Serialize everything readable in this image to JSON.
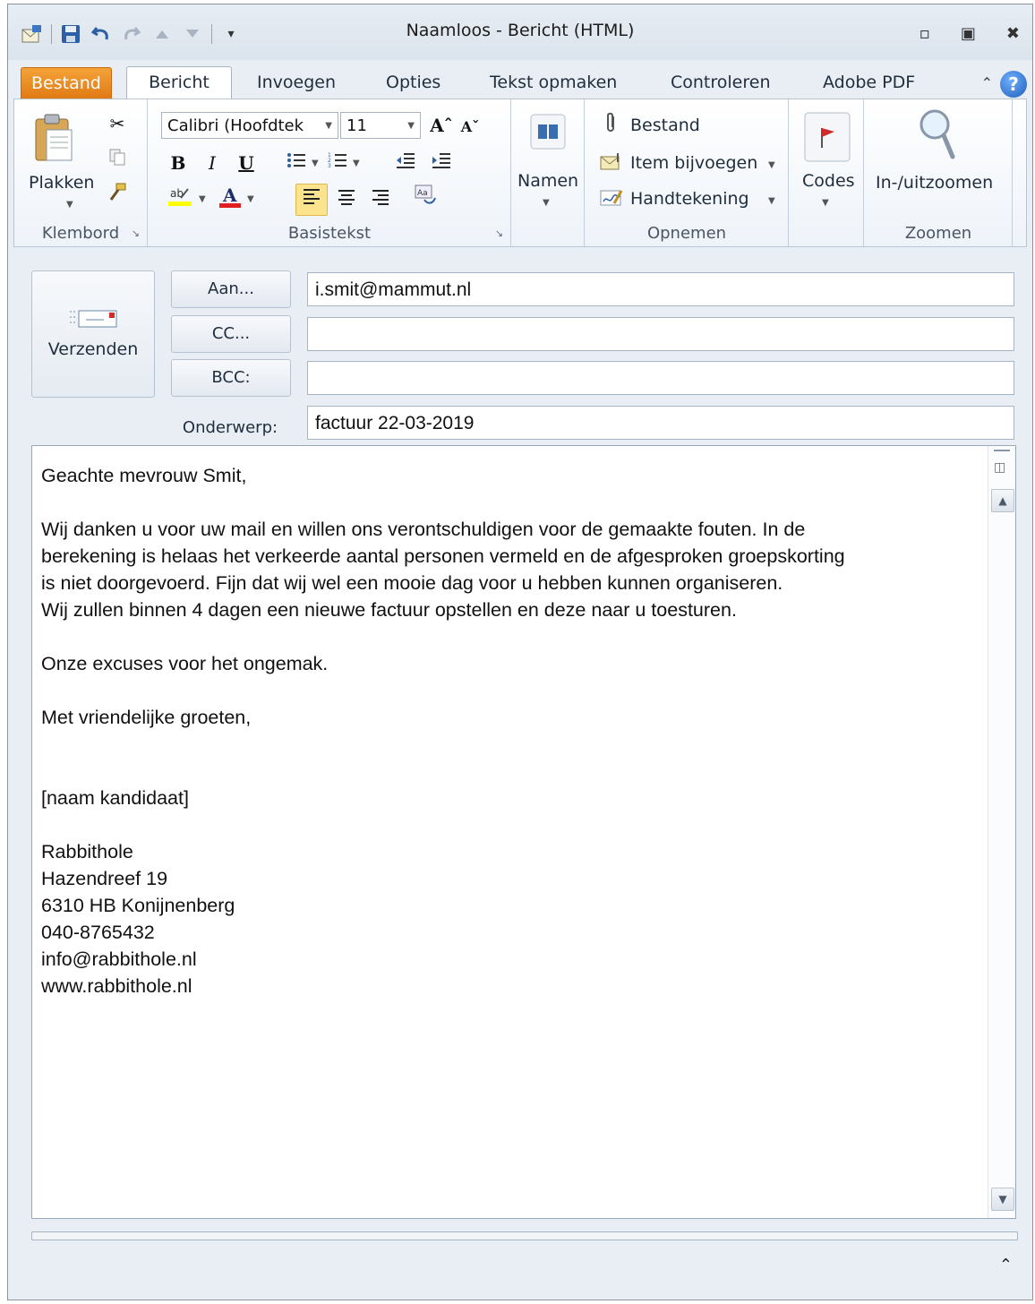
{
  "window": {
    "title": "Naamloos - Bericht (HTML)",
    "controls": [
      "minimize-icon",
      "restore-icon",
      "close-icon"
    ]
  },
  "tabs": [
    "Bestand",
    "Bericht",
    "Invoegen",
    "Opties",
    "Tekst opmaken",
    "Controleren",
    "Adobe PDF"
  ],
  "active_tab": "Bericht",
  "ribbon": {
    "clipboard": {
      "paste_label": "Plakken",
      "group_label": "Klembord"
    },
    "basic_text": {
      "font_name": "Calibri (Hoofdtek",
      "font_size": "11",
      "bold": "B",
      "italic": "I",
      "underline": "U",
      "group_label": "Basistekst"
    },
    "names": {
      "label": "Namen"
    },
    "include": {
      "file_label": "Bestand",
      "item_label": "Item bijvoegen",
      "signature_label": "Handtekening",
      "group_label": "Opnemen"
    },
    "tags": {
      "label": "Codes"
    },
    "zoom": {
      "label": "In-/uitzoomen",
      "group_label": "Zoomen"
    }
  },
  "header": {
    "send_label": "Verzenden",
    "to_button": "Aan...",
    "cc_button": "CC...",
    "bcc_button": "BCC:",
    "subject_label": "Onderwerp:",
    "to_value": "i.smit@mammut.nl",
    "cc_value": "",
    "bcc_value": "",
    "subject_value": "factuur 22-03-2019"
  },
  "body": {
    "greeting": "Geachte mevrouw Smit,",
    "para1_line1": "Wij danken u voor uw mail en willen ons verontschuldigen voor de gemaakte fouten. In de",
    "para1_line2": "berekening is helaas het verkeerde aantal personen vermeld en de afgesproken groepskorting",
    "para1_line3": "is niet doorgevoerd. Fijn dat wij wel een mooie dag voor u hebben kunnen organiseren.",
    "para1_line4": "Wij zullen binnen 4 dagen een nieuwe factuur opstellen en deze naar u toesturen.",
    "apology": "Onze excuses voor het ongemak.",
    "closing": "Met vriendelijke groeten,",
    "signature_name": "[naam kandidaat]",
    "company": "Rabbithole",
    "street": "Hazendreef 19",
    "city": "6310 HB Konijnenberg",
    "phone": "040-8765432",
    "email": "info@rabbithole.nl",
    "website": "www.rabbithole.nl"
  },
  "colors": {
    "file_tab": "#e07a14",
    "accent": "#1f5fb8",
    "background": "#e9eef4"
  }
}
